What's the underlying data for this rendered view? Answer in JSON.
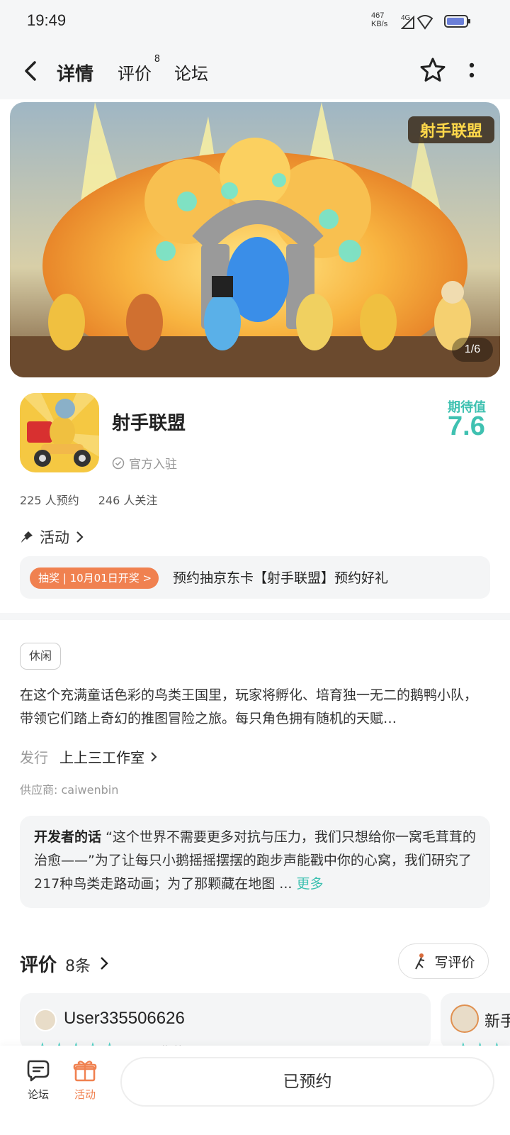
{
  "status_bar": {
    "time": "19:49",
    "speed_value": "467",
    "speed_unit": "KB/s",
    "network": "4G"
  },
  "nav": {
    "tabs": [
      "详情",
      "评价",
      "论坛"
    ],
    "review_badge": "8"
  },
  "banner": {
    "counter": "1/6",
    "logo_text": "射手联盟"
  },
  "app": {
    "name": "射手联盟",
    "official_label": "官方入驻",
    "expect_label": "期待值",
    "expect_value": "7.6"
  },
  "stats": {
    "reservations": "225 人预约",
    "followers": "246 人关注"
  },
  "activity": {
    "heading": "活动",
    "badge": "抽奖 | 10月01日开奖 >",
    "text": "预约抽京东卡【射手联盟】预约好礼"
  },
  "detail": {
    "tag": "休闲",
    "description": "在这个充满童话色彩的鸟类王国里，玩家将孵化、培育独一无二的鹅鸭小队，带领它们踏上奇幻的推图冒险之旅。每只角色拥有随机的天赋…",
    "publisher_label": "发行",
    "publisher_name": "上上三工作室",
    "supplier": "供应商: caiwenbin"
  },
  "developer_note": {
    "title": "开发者的话",
    "text": "“这个世界不需要更多对抗与压力，我们只想给你一窝毛茸茸的治愈——”为了让每只小鹅摇摇摆摆的跑步声能戳中你的心窝，我们研究了217种鸟类走路动画；为了那颗藏在地图 ...",
    "more": "更多"
  },
  "reviews": {
    "title": "评价",
    "count": "8条",
    "write_label": "写评价",
    "cards": [
      {
        "user": "User335506626",
        "stars": "★★★★★",
        "tag": "期待"
      },
      {
        "user": "新手",
        "stars": "★★★",
        "tag": ""
      }
    ]
  },
  "bottom_bar": {
    "forum_label": "论坛",
    "activity_label": "活动",
    "reserve_label": "已预约"
  },
  "colors": {
    "accent": "#3fc1b1",
    "orange": "#f08150",
    "card_bg": "#f4f5f6"
  }
}
